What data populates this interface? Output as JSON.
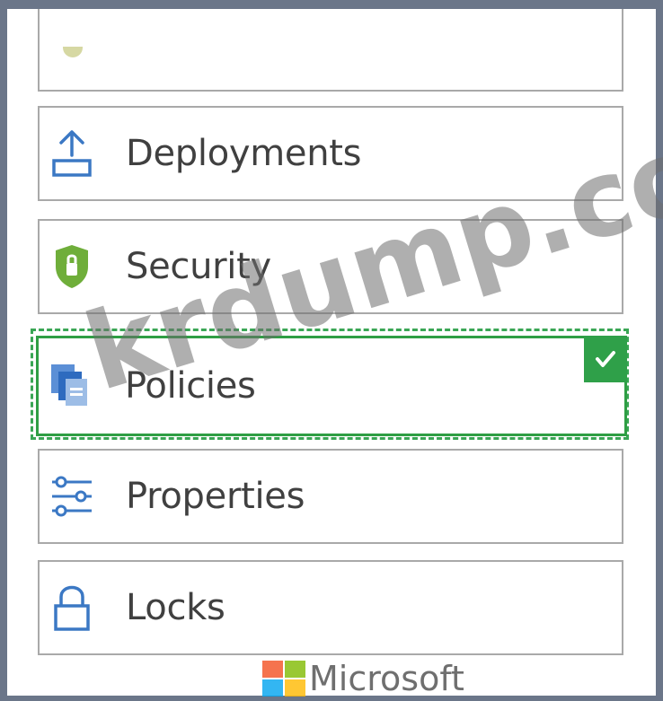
{
  "menu": {
    "items": [
      {
        "id": "deployments",
        "label": "Deployments",
        "icon": "upload-icon"
      },
      {
        "id": "security",
        "label": "Security",
        "icon": "shield-icon"
      },
      {
        "id": "policies",
        "label": "Policies",
        "icon": "policy-documents-icon",
        "selected": true
      },
      {
        "id": "properties",
        "label": "Properties",
        "icon": "sliders-icon"
      },
      {
        "id": "locks",
        "label": "Locks",
        "icon": "lock-icon"
      }
    ]
  },
  "watermark": "krdump.com",
  "brand": {
    "name": "Microsoft"
  },
  "colors": {
    "frame": "#6b7689",
    "selection": "#2f9e44",
    "icon_blue": "#3b78c4",
    "shield_green": "#6fae3a"
  }
}
